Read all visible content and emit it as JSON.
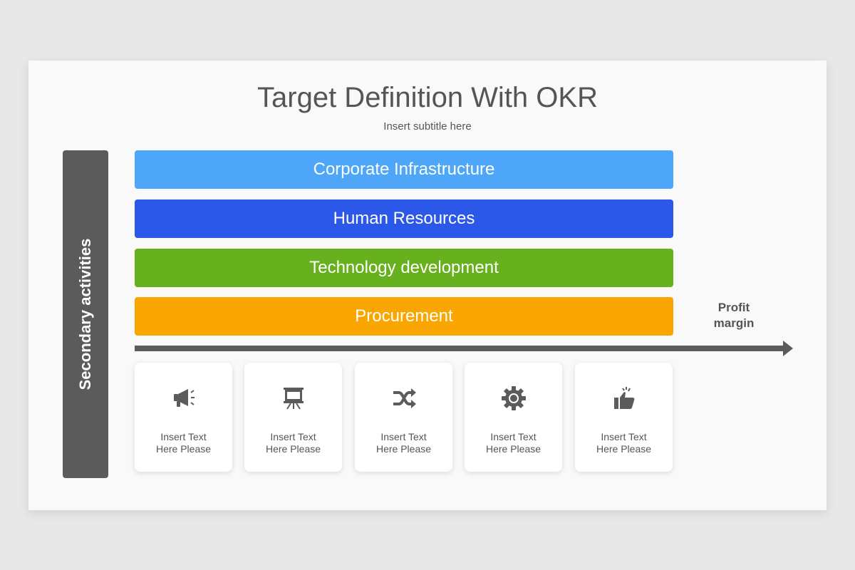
{
  "title": "Target Definition With OKR",
  "subtitle": "Insert subtitle here",
  "side_label": "Secondary activities",
  "bands": [
    {
      "label": "Corporate Infrastructure",
      "color": "#4da6f7"
    },
    {
      "label": "Human Resources",
      "color": "#2b58e8"
    },
    {
      "label": "Technology development",
      "color": "#67b11e"
    },
    {
      "label": "Procurement",
      "color": "#f9a600"
    }
  ],
  "profit_label": "Profit margin",
  "cards": [
    {
      "icon": "megaphone-icon",
      "line1": "Insert Text",
      "line2": "Here Please"
    },
    {
      "icon": "presentation-board-icon",
      "line1": "Insert Text",
      "line2": "Here Please"
    },
    {
      "icon": "shuffle-icon",
      "line1": "Insert Text",
      "line2": "Here Please"
    },
    {
      "icon": "gear-icon",
      "line1": "Insert Text",
      "line2": "Here Please"
    },
    {
      "icon": "thumbs-up-icon",
      "line1": "Insert Text",
      "line2": "Here Please"
    }
  ],
  "colors": {
    "dark": "#5b5b5b",
    "text": "#555555"
  }
}
